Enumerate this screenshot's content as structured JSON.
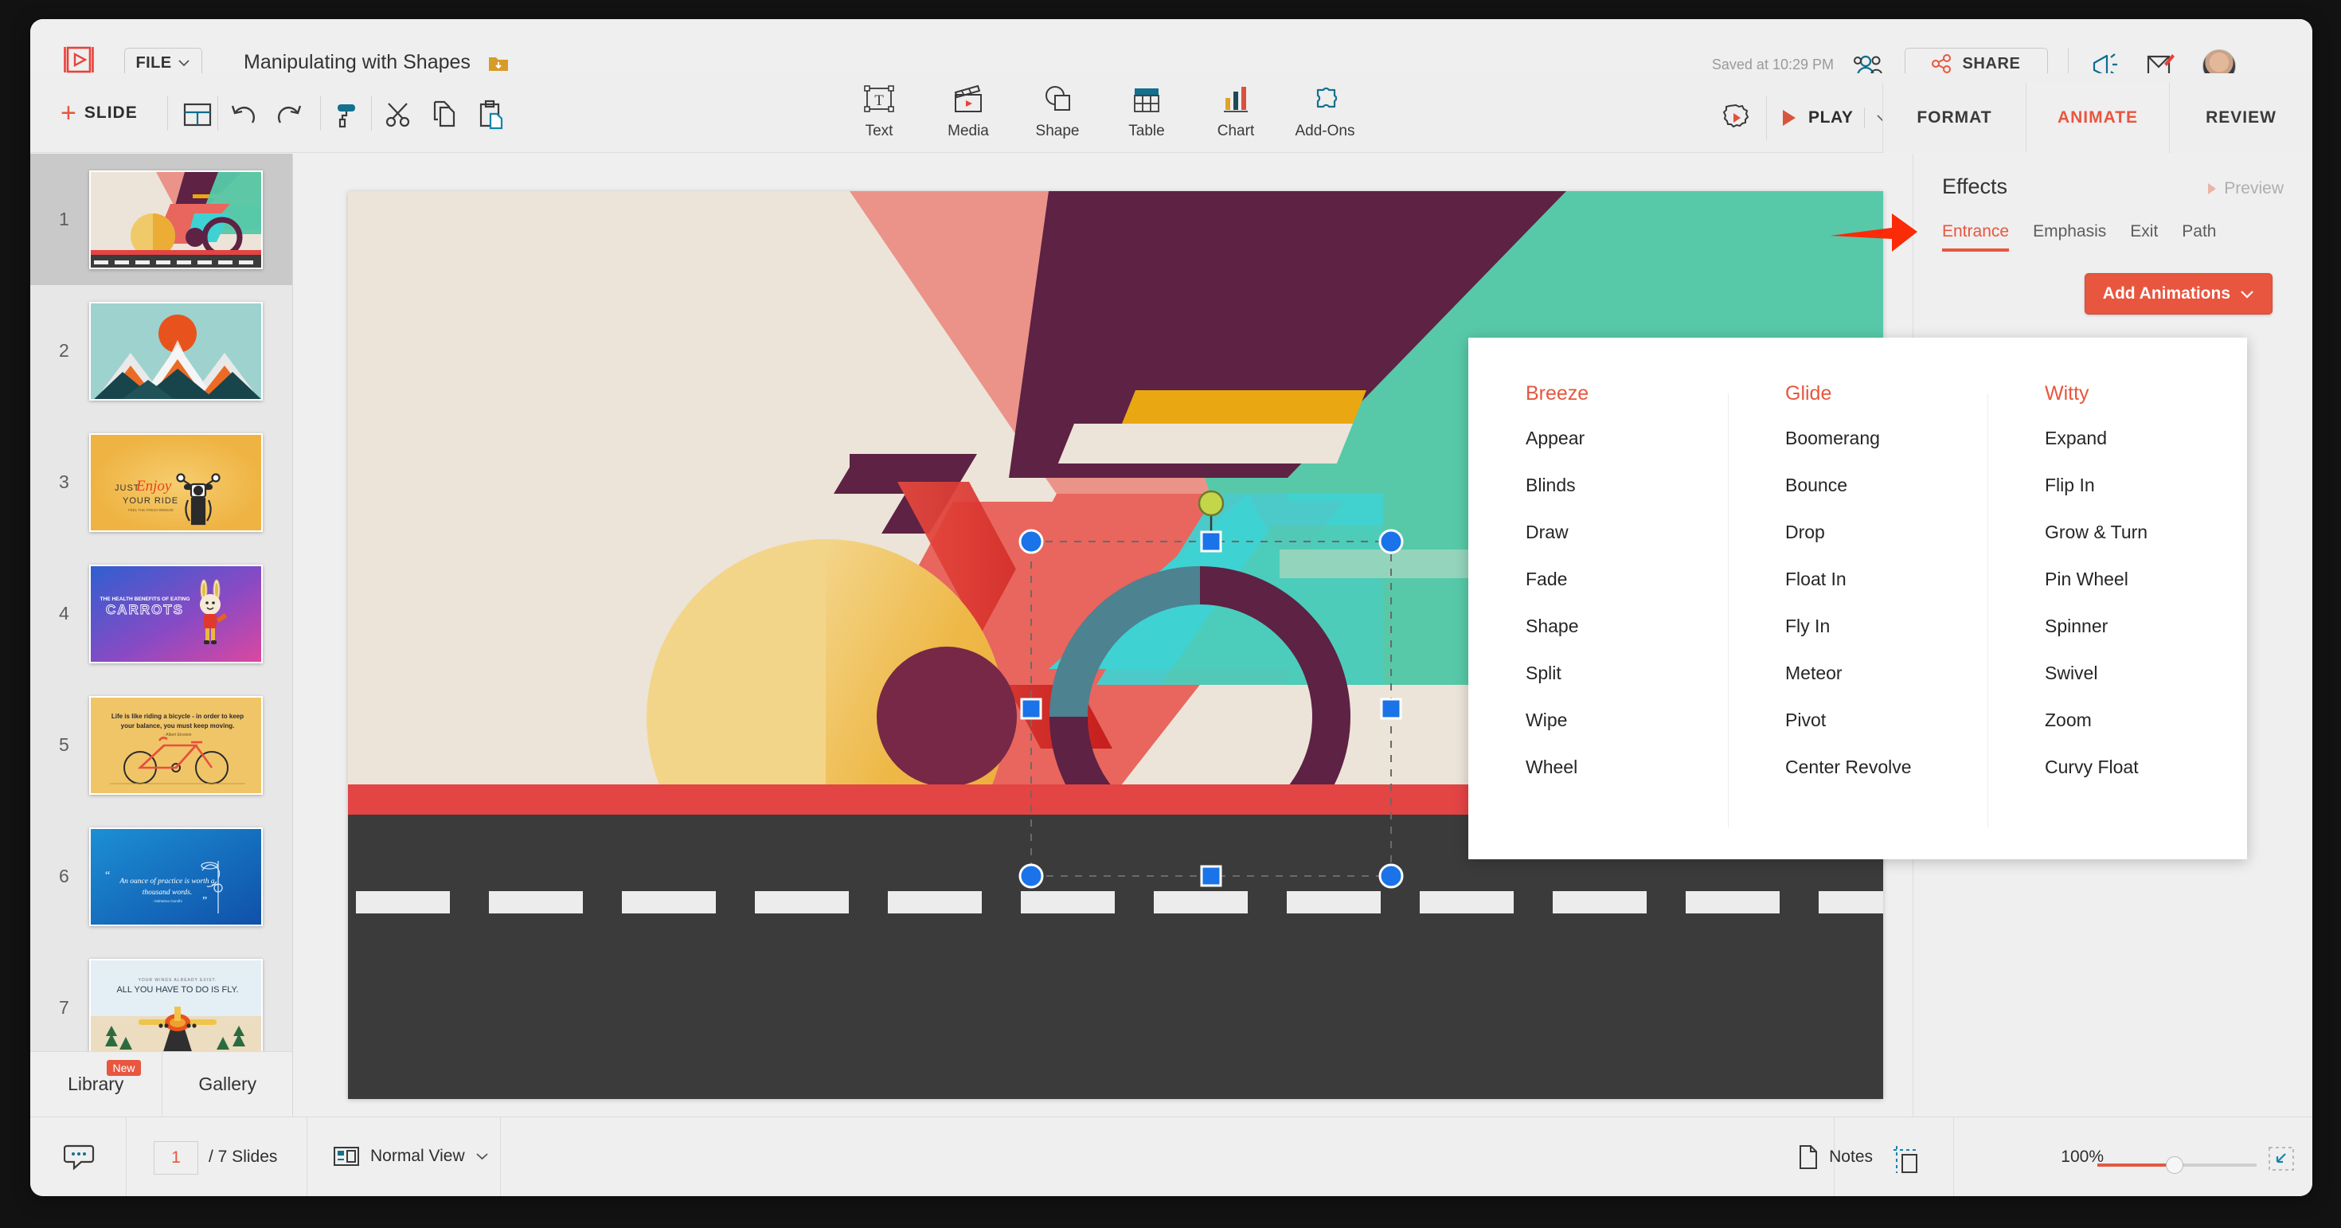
{
  "app": {
    "logo_icon": "presentation-logo-icon",
    "file_menu_label": "FILE",
    "document_title": "Manipulating with Shapes",
    "folder_icon": "folder-download-icon",
    "saved_status": "Saved at 10:29 PM",
    "collaborators_icon": "collaborators-icon",
    "share_label": "SHARE",
    "share_icon": "share-nodes-icon",
    "megaphone_icon": "megaphone-icon",
    "feedback_icon": "feedback-edit-icon",
    "avatar_icon": "user-avatar"
  },
  "toolbar": {
    "add_slide_label": "SLIDE",
    "add_slide_plus": "+",
    "layout_icon": "slide-layout-icon",
    "undo_icon": "undo-icon",
    "redo_icon": "redo-icon",
    "format_painter_icon": "paint-roller-icon",
    "cut_icon": "scissors-icon",
    "copy_icon": "copy-icon",
    "paste_icon": "paste-icon",
    "insert_tools": [
      {
        "label": "Text",
        "icon": "text-box-icon"
      },
      {
        "label": "Media",
        "icon": "media-clapperboard-icon"
      },
      {
        "label": "Shape",
        "icon": "shape-icon"
      },
      {
        "label": "Table",
        "icon": "table-icon"
      },
      {
        "label": "Chart",
        "icon": "bar-chart-icon"
      },
      {
        "label": "Add-Ons",
        "icon": "puzzle-piece-icon"
      }
    ],
    "settings_icon": "gear-play-icon",
    "play_label": "PLAY",
    "play_icon": "play-triangle-icon",
    "play_dropdown_icon": "chevron-down-icon",
    "ribbon_tabs": [
      {
        "label": "FORMAT",
        "active": false
      },
      {
        "label": "ANIMATE",
        "active": true
      },
      {
        "label": "REVIEW",
        "active": false
      }
    ]
  },
  "slide_panel": {
    "slides": [
      {
        "number": "1",
        "selected": true,
        "caption": "bicycle geometric flat illustration"
      },
      {
        "number": "2",
        "selected": false,
        "caption": "mountains with sun"
      },
      {
        "number": "3",
        "selected": false,
        "caption": "JUST Enjoy YOUR RIDE motorcycle"
      },
      {
        "number": "4",
        "selected": false,
        "caption": "THE HEALTH BENEFITS OF EATING CARROTS"
      },
      {
        "number": "5",
        "selected": false,
        "caption": "Life is like riding a bicycle quote"
      },
      {
        "number": "6",
        "selected": false,
        "caption": "An ounce of practice is worth a thousand words."
      },
      {
        "number": "7",
        "selected": false,
        "caption": "ALL YOU HAVE TO DO IS FLY."
      }
    ],
    "tabs": [
      {
        "label": "Library",
        "badge": "New"
      },
      {
        "label": "Gallery",
        "badge": ""
      }
    ],
    "resize_grip_icon": "panel-resize-grip-icon"
  },
  "right_panel": {
    "heading": "Effects",
    "preview_label": "Preview",
    "preview_icon": "play-small-icon",
    "effect_tabs": [
      {
        "label": "Entrance",
        "active": true
      },
      {
        "label": "Emphasis",
        "active": false
      },
      {
        "label": "Exit",
        "active": false
      },
      {
        "label": "Path",
        "active": false
      }
    ],
    "add_animations_label": "Add Animations",
    "add_animations_caret": "chevron-down-icon",
    "animation_menu": {
      "columns": [
        {
          "title": "Breeze",
          "items": [
            "Appear",
            "Blinds",
            "Draw",
            "Fade",
            "Shape",
            "Split",
            "Wipe",
            "Wheel"
          ]
        },
        {
          "title": "Glide",
          "items": [
            "Boomerang",
            "Bounce",
            "Drop",
            "Float In",
            "Fly In",
            "Meteor",
            "Pivot",
            "Center Revolve"
          ]
        },
        {
          "title": "Witty",
          "items": [
            "Expand",
            "Flip In",
            "Grow & Turn",
            "Pin Wheel",
            "Spinner",
            "Swivel",
            "Zoom",
            "Curvy Float"
          ]
        }
      ]
    },
    "annotation_arrow_icon": "red-annotation-arrow-icon"
  },
  "status_bar": {
    "comment_icon": "comment-icon",
    "current_slide": "1",
    "slide_total_label": "/ 7 Slides",
    "view_mode": "Normal View",
    "view_icon": "normal-view-icon",
    "view_caret": "chevron-down-icon",
    "notes_label": "Notes",
    "notes_icon": "notes-page-icon",
    "guides_icon": "guides-icon",
    "zoom_level": "100%",
    "fit_icon": "fit-to-screen-icon"
  },
  "colors": {
    "accent_red": "#e8563f",
    "teal": "#57c9a8",
    "purple": "#5d2244",
    "salmon": "#eb9389",
    "coral": "#e8665e",
    "cream": "#ece4d8",
    "gold": "#e9a811",
    "yellow": "#f0c969",
    "cyan": "#3fd2d2",
    "road_dark": "#3b3b3b",
    "red_stripe": "#e34444",
    "selection_blue": "#1a73e8"
  }
}
